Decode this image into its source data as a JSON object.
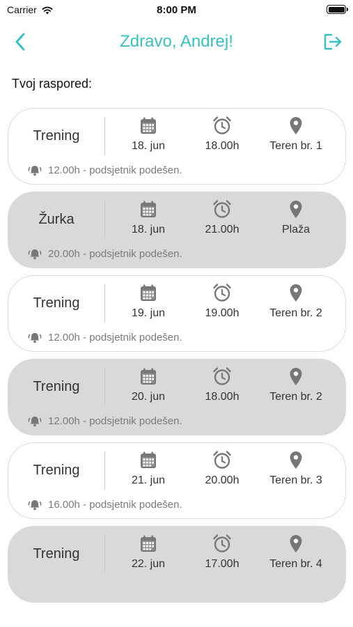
{
  "status_bar": {
    "carrier": "Carrier",
    "time": "8:00 PM"
  },
  "header": {
    "title": "Zdravo, Andrej!"
  },
  "schedule_label": "Tvoj raspored:",
  "events": [
    {
      "name": "Trening",
      "date": "18. jun",
      "time": "18.00h",
      "place": "Teren br. 1",
      "reminder": "12.00h - podsjetnik podešen.",
      "highlighted": false
    },
    {
      "name": "Žurka",
      "date": "18. jun",
      "time": "21.00h",
      "place": "Plaža",
      "reminder": "20.00h - podsjetnik podešen.",
      "highlighted": true
    },
    {
      "name": "Trening",
      "date": "19. jun",
      "time": "19.00h",
      "place": "Teren br. 2",
      "reminder": "12.00h - podsjetnik podešen.",
      "highlighted": false
    },
    {
      "name": "Trening",
      "date": "20. jun",
      "time": "18.00h",
      "place": "Teren br. 2",
      "reminder": "12.00h - podsjetnik podešen.",
      "highlighted": true
    },
    {
      "name": "Trening",
      "date": "21. jun",
      "time": "20.00h",
      "place": "Teren br. 3",
      "reminder": "16.00h - podsjetnik podešen.",
      "highlighted": false
    },
    {
      "name": "Trening",
      "date": "22. jun",
      "time": "17.00h",
      "place": "Teren br. 4",
      "reminder": "",
      "highlighted": true
    }
  ],
  "colors": {
    "accent": "#39c0c0",
    "card_highlight": "#d9d9d9",
    "icon": "#777777"
  },
  "icons": {
    "back": "chevron-left-icon",
    "logout": "logout-icon",
    "date": "calendar-icon",
    "time": "alarm-clock-icon",
    "place": "location-pin-icon",
    "reminder": "bell-icon"
  }
}
